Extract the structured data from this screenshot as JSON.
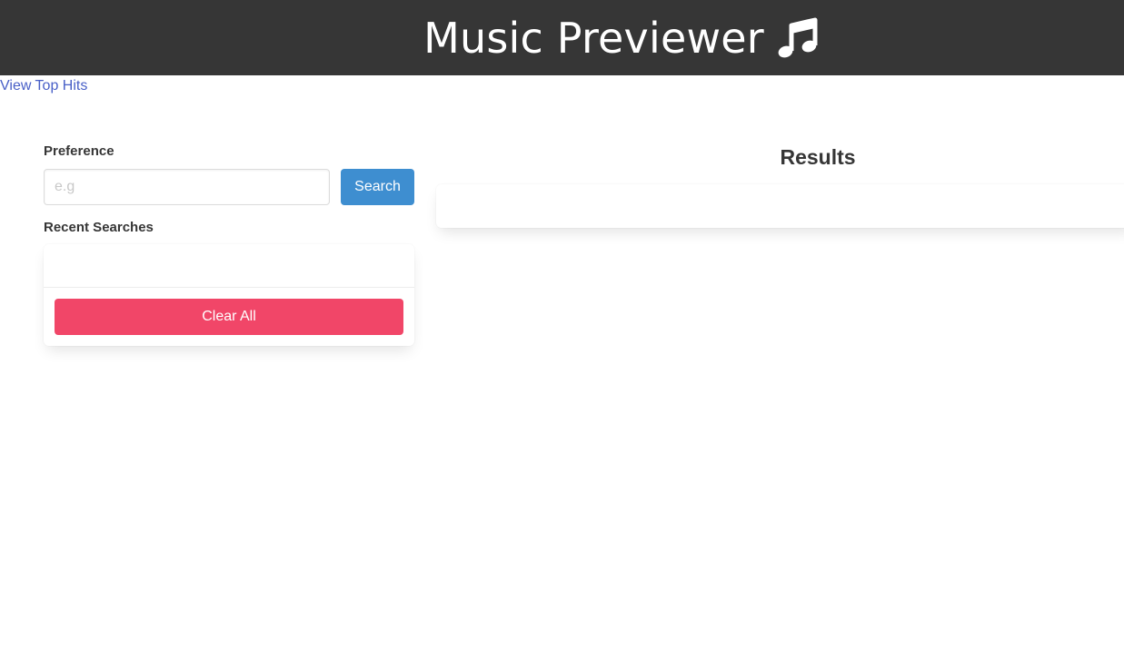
{
  "header": {
    "title": "Music Previewer",
    "icon": "music-note-icon",
    "background_color": "#363636"
  },
  "nav": {
    "top_hits_link": "View Top Hits"
  },
  "search": {
    "label": "Preference",
    "placeholder": "e.g",
    "value": "",
    "button_label": "Search",
    "button_color": "#3e8ed0"
  },
  "recent": {
    "label": "Recent Searches",
    "items": [],
    "clear_label": "Clear All",
    "clear_color": "#f14668"
  },
  "results": {
    "title": "Results",
    "items": []
  }
}
